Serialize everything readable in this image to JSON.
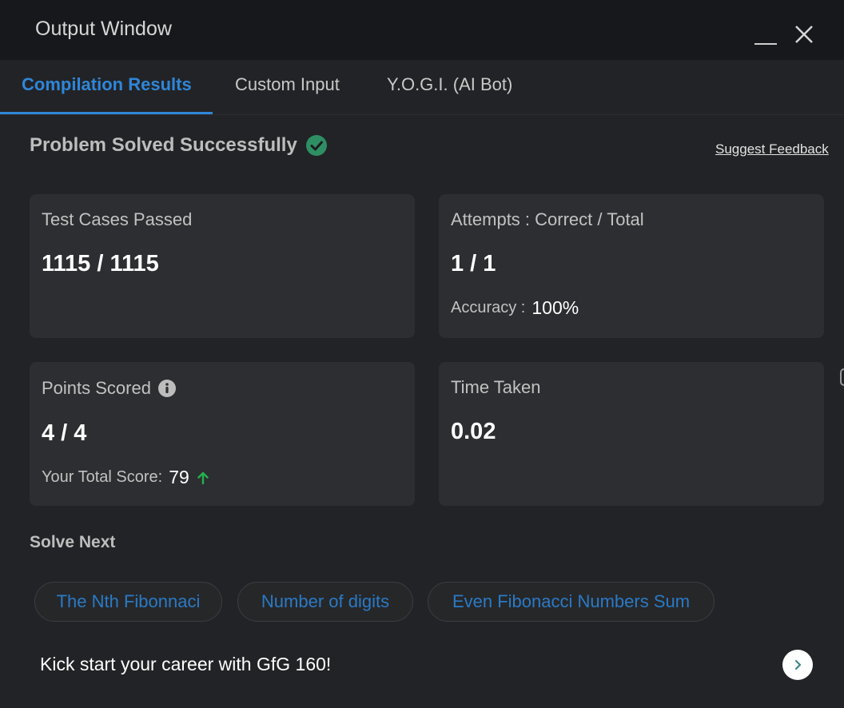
{
  "window": {
    "title": "Output Window"
  },
  "tabs": [
    {
      "label": "Compilation Results",
      "active": true
    },
    {
      "label": "Custom Input",
      "active": false
    },
    {
      "label": "Y.O.G.I. (AI Bot)",
      "active": false
    }
  ],
  "status": {
    "text": "Problem Solved Successfully",
    "icon": "check-circle-icon"
  },
  "feedback_link": "Suggest Feedback",
  "cards": {
    "test_cases": {
      "label": "Test Cases Passed",
      "value": "1115 / 1115"
    },
    "attempts": {
      "label": "Attempts : Correct / Total",
      "value": "1 / 1",
      "accuracy_label": "Accuracy :",
      "accuracy_value": "100%"
    },
    "points": {
      "label": "Points Scored",
      "value": "4 / 4",
      "total_label": "Your Total Score:",
      "total_value": "79"
    },
    "time": {
      "label": "Time Taken",
      "value": "0.02"
    }
  },
  "solve_next": {
    "heading": "Solve Next",
    "items": [
      "The Nth Fibonnaci",
      "Number of digits",
      "Even Fibonacci Numbers Sum"
    ]
  },
  "promo": {
    "text": "Kick start your career with GfG 160!"
  },
  "colors": {
    "accent": "#2f86d8",
    "success": "#2e9e6b",
    "up_arrow": "#22b24c",
    "background": "#222326",
    "card": "#2d2e31"
  }
}
